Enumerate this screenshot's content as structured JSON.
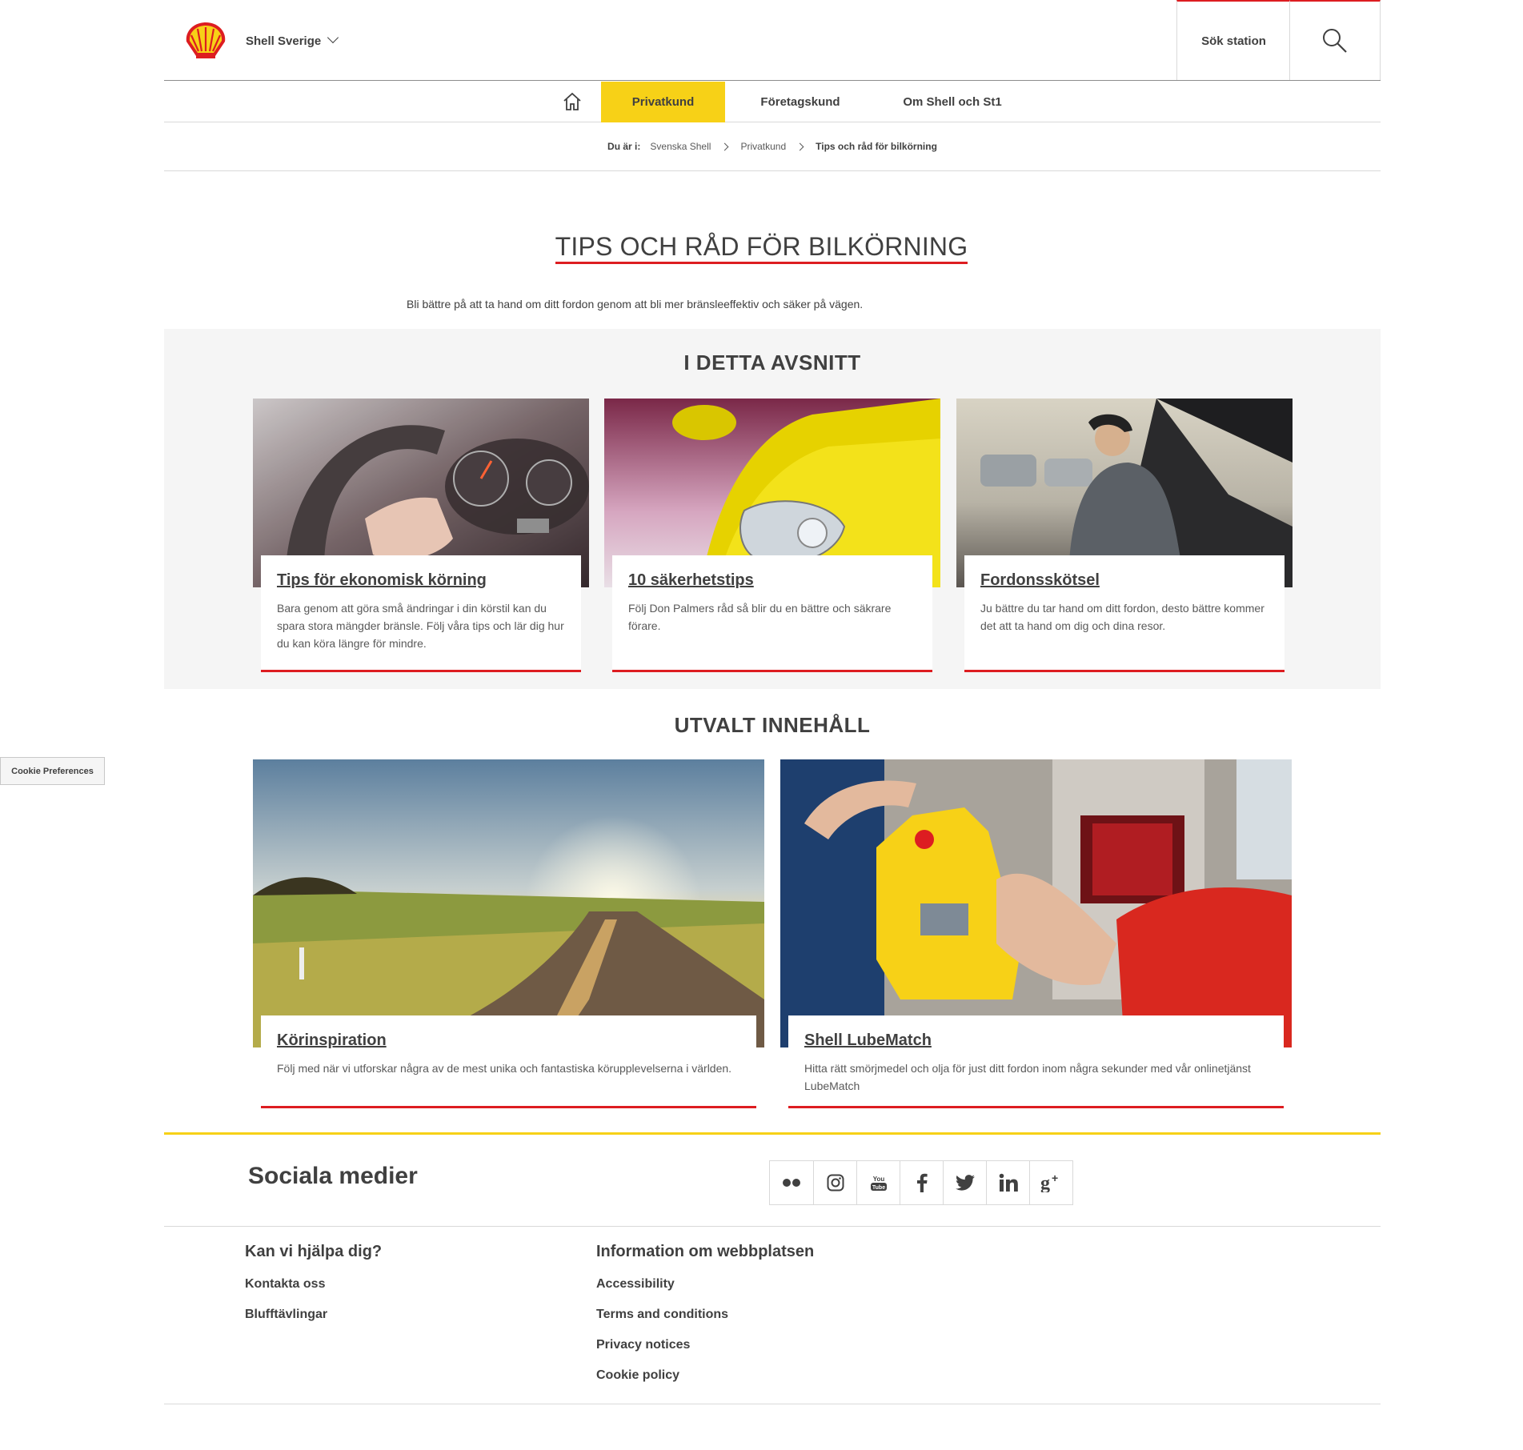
{
  "header": {
    "country": "Shell Sverige",
    "station_label": "Sök station"
  },
  "nav": {
    "items": [
      {
        "label": "Privatkund",
        "active": true
      },
      {
        "label": "Företagskund"
      },
      {
        "label": "Om Shell och St1"
      }
    ]
  },
  "breadcrumb": {
    "prefix": "Du är i:",
    "items": [
      "Svenska Shell",
      "Privatkund",
      "Tips och råd för bilkörning"
    ]
  },
  "page": {
    "title": "TIPS OCH RÅD FÖR BILKÖRNING",
    "intro": "Bli bättre på att ta hand om ditt fordon genom att bli mer bränsleeffektiv och säker på vägen."
  },
  "section1": {
    "heading": "I DETTA AVSNITT",
    "cards": [
      {
        "title": "Tips för ekonomisk körning",
        "desc": "Bara genom att göra små ändringar i din körstil kan du spara stora mängder bränsle. Följ våra tips och lär dig hur du kan köra längre för mindre."
      },
      {
        "title": "10 säkerhetstips",
        "desc": "Följ Don Palmers råd så blir du en bättre och säkrare förare."
      },
      {
        "title": "Fordonsskötsel",
        "desc": "Ju bättre du tar hand om ditt fordon, desto bättre kommer det att ta hand om dig och dina resor."
      }
    ]
  },
  "section2": {
    "heading": "UTVALT INNEHÅLL",
    "cards": [
      {
        "title": "Körinspiration",
        "desc": "Följ med när vi utforskar några av de mest unika och fantastiska körupplevelserna i världen."
      },
      {
        "title": "Shell LubeMatch",
        "desc": "Hitta rätt smörjmedel och olja för just ditt fordon inom några sekunder med vår onlinetjänst LubeMatch"
      }
    ]
  },
  "social": {
    "heading": "Sociala medier",
    "icons": [
      "flickr-icon",
      "instagram-icon",
      "youtube-icon",
      "facebook-icon",
      "twitter-icon",
      "linkedin-icon",
      "googleplus-icon"
    ],
    "glyphs": [
      "●●",
      "◎",
      "You\nTube",
      "f",
      "🐦",
      "in",
      "g+"
    ]
  },
  "footer": {
    "help": {
      "heading": "Kan vi hjälpa dig?",
      "links": [
        "Kontakta oss",
        "Blufftävlingar"
      ]
    },
    "info": {
      "heading": "Information om webbplatsen",
      "links": [
        "Accessibility",
        "Terms and conditions",
        "Privacy notices",
        "Cookie policy"
      ]
    }
  },
  "cookie_button": "Cookie Preferences",
  "colors": {
    "shell_yellow": "#f7d117",
    "shell_red": "#dd1d21"
  }
}
